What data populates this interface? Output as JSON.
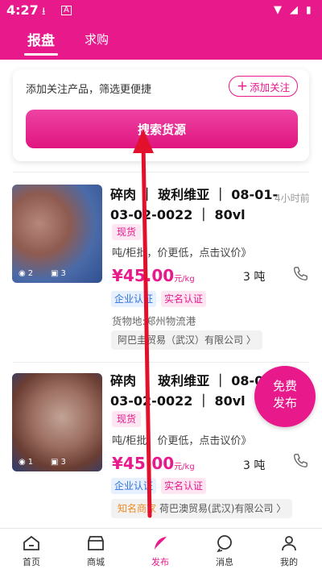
{
  "status_bar": {
    "time": "4:27"
  },
  "tabs": [
    {
      "label": "报盘",
      "active": true
    },
    {
      "label": "求购",
      "active": false
    }
  ],
  "search_card": {
    "hint": "添加关注产品，筛选更便捷",
    "follow_label": "添加关注",
    "search_label": "搜索货源"
  },
  "products": [
    {
      "title": "碎肉 ｜ 玻利维亚 ｜ 08-01-03-02-0022 ｜ 80vl",
      "time": "4小时前",
      "tag": "现货",
      "desc": "吨/柜批，价更低，点击议价》",
      "price": "¥45.00",
      "unit": "元/kg",
      "qty": "3 吨",
      "badge_enterprise": "企业认证",
      "badge_realname": "实名认证",
      "location": "货物地:郑州物流港",
      "company": "阿巴圭贸易（武汉）有限公司 〉",
      "famous": "",
      "views": "2",
      "photos": "3"
    },
    {
      "title": "碎肉 ｜ 玻利维亚 ｜ 08-01-03-02-0022 ｜ 80vl",
      "time": "",
      "tag": "现货",
      "desc": "吨/柜批，价更低，点击议价》",
      "price": "¥45.00",
      "unit": "元/kg",
      "qty": "3 吨",
      "badge_enterprise": "企业认证",
      "badge_realname": "实名认证",
      "location": "",
      "company": "荷巴澳贸易(武汉)有限公司 〉",
      "famous": "知名商家",
      "views": "1",
      "photos": "3"
    }
  ],
  "float_button": {
    "line1": "免费",
    "line2": "发布"
  },
  "bottom_nav": [
    {
      "label": "首页",
      "icon": "home-icon"
    },
    {
      "label": "商城",
      "icon": "store-icon"
    },
    {
      "label": "发布",
      "icon": "feather-icon",
      "active": true
    },
    {
      "label": "消息",
      "icon": "chat-icon"
    },
    {
      "label": "我的",
      "icon": "user-icon"
    }
  ],
  "colors": {
    "brand": "#e8198b",
    "arrow": "#e3102d"
  }
}
